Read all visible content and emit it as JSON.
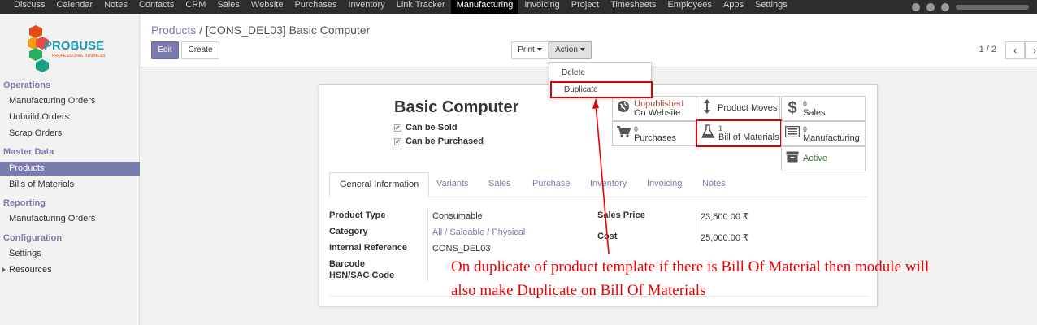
{
  "topnav": {
    "items": [
      "Discuss",
      "Calendar",
      "Notes",
      "Contacts",
      "CRM",
      "Sales",
      "Website",
      "Purchases",
      "Inventory",
      "Link Tracker",
      "Manufacturing",
      "Invoicing",
      "Project",
      "Timesheets",
      "Employees",
      "Apps",
      "Settings"
    ],
    "active": "Manufacturing"
  },
  "logo": {
    "name": "PROBUSE",
    "tagline": "PROFESSIONAL BUSINESS"
  },
  "sidebar": {
    "operations": "Operations",
    "mo": "Manufacturing Orders",
    "unbuild": "Unbuild Orders",
    "scrap": "Scrap Orders",
    "master": "Master Data",
    "products": "Products",
    "bom": "Bills of Materials",
    "reporting": "Reporting",
    "rep_mo": "Manufacturing Orders",
    "configuration": "Configuration",
    "settings": "Settings",
    "resources": "Resources"
  },
  "breadcrumb": {
    "parent": "Products",
    "sep": "/",
    "current": "[CONS_DEL03] Basic Computer"
  },
  "buttons": {
    "edit": "Edit",
    "create": "Create",
    "print": "Print",
    "action": "Action"
  },
  "pager": {
    "text": "1 / 2",
    "prev": "‹",
    "next": "›"
  },
  "action_menu": {
    "delete": "Delete",
    "duplicate": "Duplicate"
  },
  "product": {
    "name": "Basic Computer",
    "can_be_sold": "Can be Sold",
    "can_be_purchased": "Can be Purchased"
  },
  "smart_buttons": {
    "website_status": "Unpublished",
    "website_label": "On Website",
    "product_moves": "Product Moves",
    "sales_count": "0",
    "sales_label": "Sales",
    "purchases_count": "0",
    "purchases_label": "Purchases",
    "bom_count": "1",
    "bom_label": "Bill of Materials",
    "manufacturing_count": "0",
    "manufacturing_label": "Manufacturing",
    "active_label": "Active"
  },
  "tabs": [
    "General Information",
    "Variants",
    "Sales",
    "Purchase",
    "Inventory",
    "Invoicing",
    "Notes"
  ],
  "fields": {
    "product_type_label": "Product Type",
    "product_type_value": "Consumable",
    "category_label": "Category",
    "category_value": "All / Saleable / Physical",
    "internal_ref_label": "Internal Reference",
    "internal_ref_value": "CONS_DEL03",
    "barcode_label": "Barcode",
    "hsn_label": "HSN/SAC Code",
    "sales_price_label": "Sales Price",
    "sales_price_value": "23,500.00 ₹",
    "cost_label": "Cost",
    "cost_value": "25,000.00 ₹"
  },
  "annotation": {
    "line1": "On duplicate of product template if there is Bill Of Material then module will",
    "line2": "also make Duplicate on Bill Of Materials"
  },
  "colors": {
    "accent": "#7c7bad",
    "annotation": "#e00000",
    "topbar": "#2d2d2d"
  }
}
